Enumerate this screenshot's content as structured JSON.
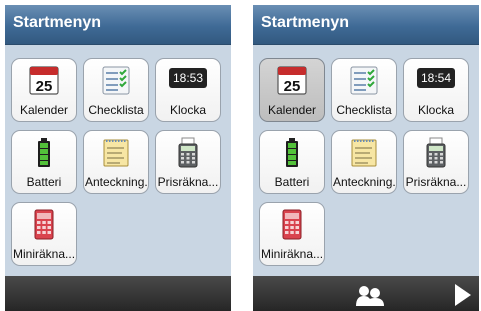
{
  "left": {
    "title": "Startmenyn",
    "apps": [
      {
        "label": "Kalender",
        "icon": "calendar-icon",
        "day": "25"
      },
      {
        "label": "Checklista",
        "icon": "checklist-icon"
      },
      {
        "label": "Klocka",
        "icon": "clock-icon",
        "time": "18:53"
      },
      {
        "label": "Batteri",
        "icon": "battery-icon"
      },
      {
        "label": "Anteckning...",
        "icon": "notepad-icon"
      },
      {
        "label": "Prisräkna...",
        "icon": "receipt-calculator-icon"
      },
      {
        "label": "Miniräkna...",
        "icon": "calculator-icon"
      }
    ]
  },
  "right": {
    "title": "Startmenyn",
    "selected_app": "Kalender",
    "apps": [
      {
        "label": "Kalender",
        "icon": "calendar-icon",
        "day": "25"
      },
      {
        "label": "Checklista",
        "icon": "checklist-icon"
      },
      {
        "label": "Klocka",
        "icon": "clock-icon",
        "time": "18:54"
      },
      {
        "label": "Batteri",
        "icon": "battery-icon"
      },
      {
        "label": "Anteckning...",
        "icon": "notepad-icon"
      },
      {
        "label": "Prisräkna...",
        "icon": "receipt-calculator-icon"
      },
      {
        "label": "Miniräkna...",
        "icon": "calculator-icon"
      }
    ],
    "bottom_icons": [
      "contacts-icon",
      "next-arrow-icon"
    ]
  },
  "colors": {
    "title_bar": "#3f6a96",
    "background": "#c9d6e3",
    "bottom_bar": "#2a2a2a",
    "selected_tile": "#c4c4c4"
  }
}
